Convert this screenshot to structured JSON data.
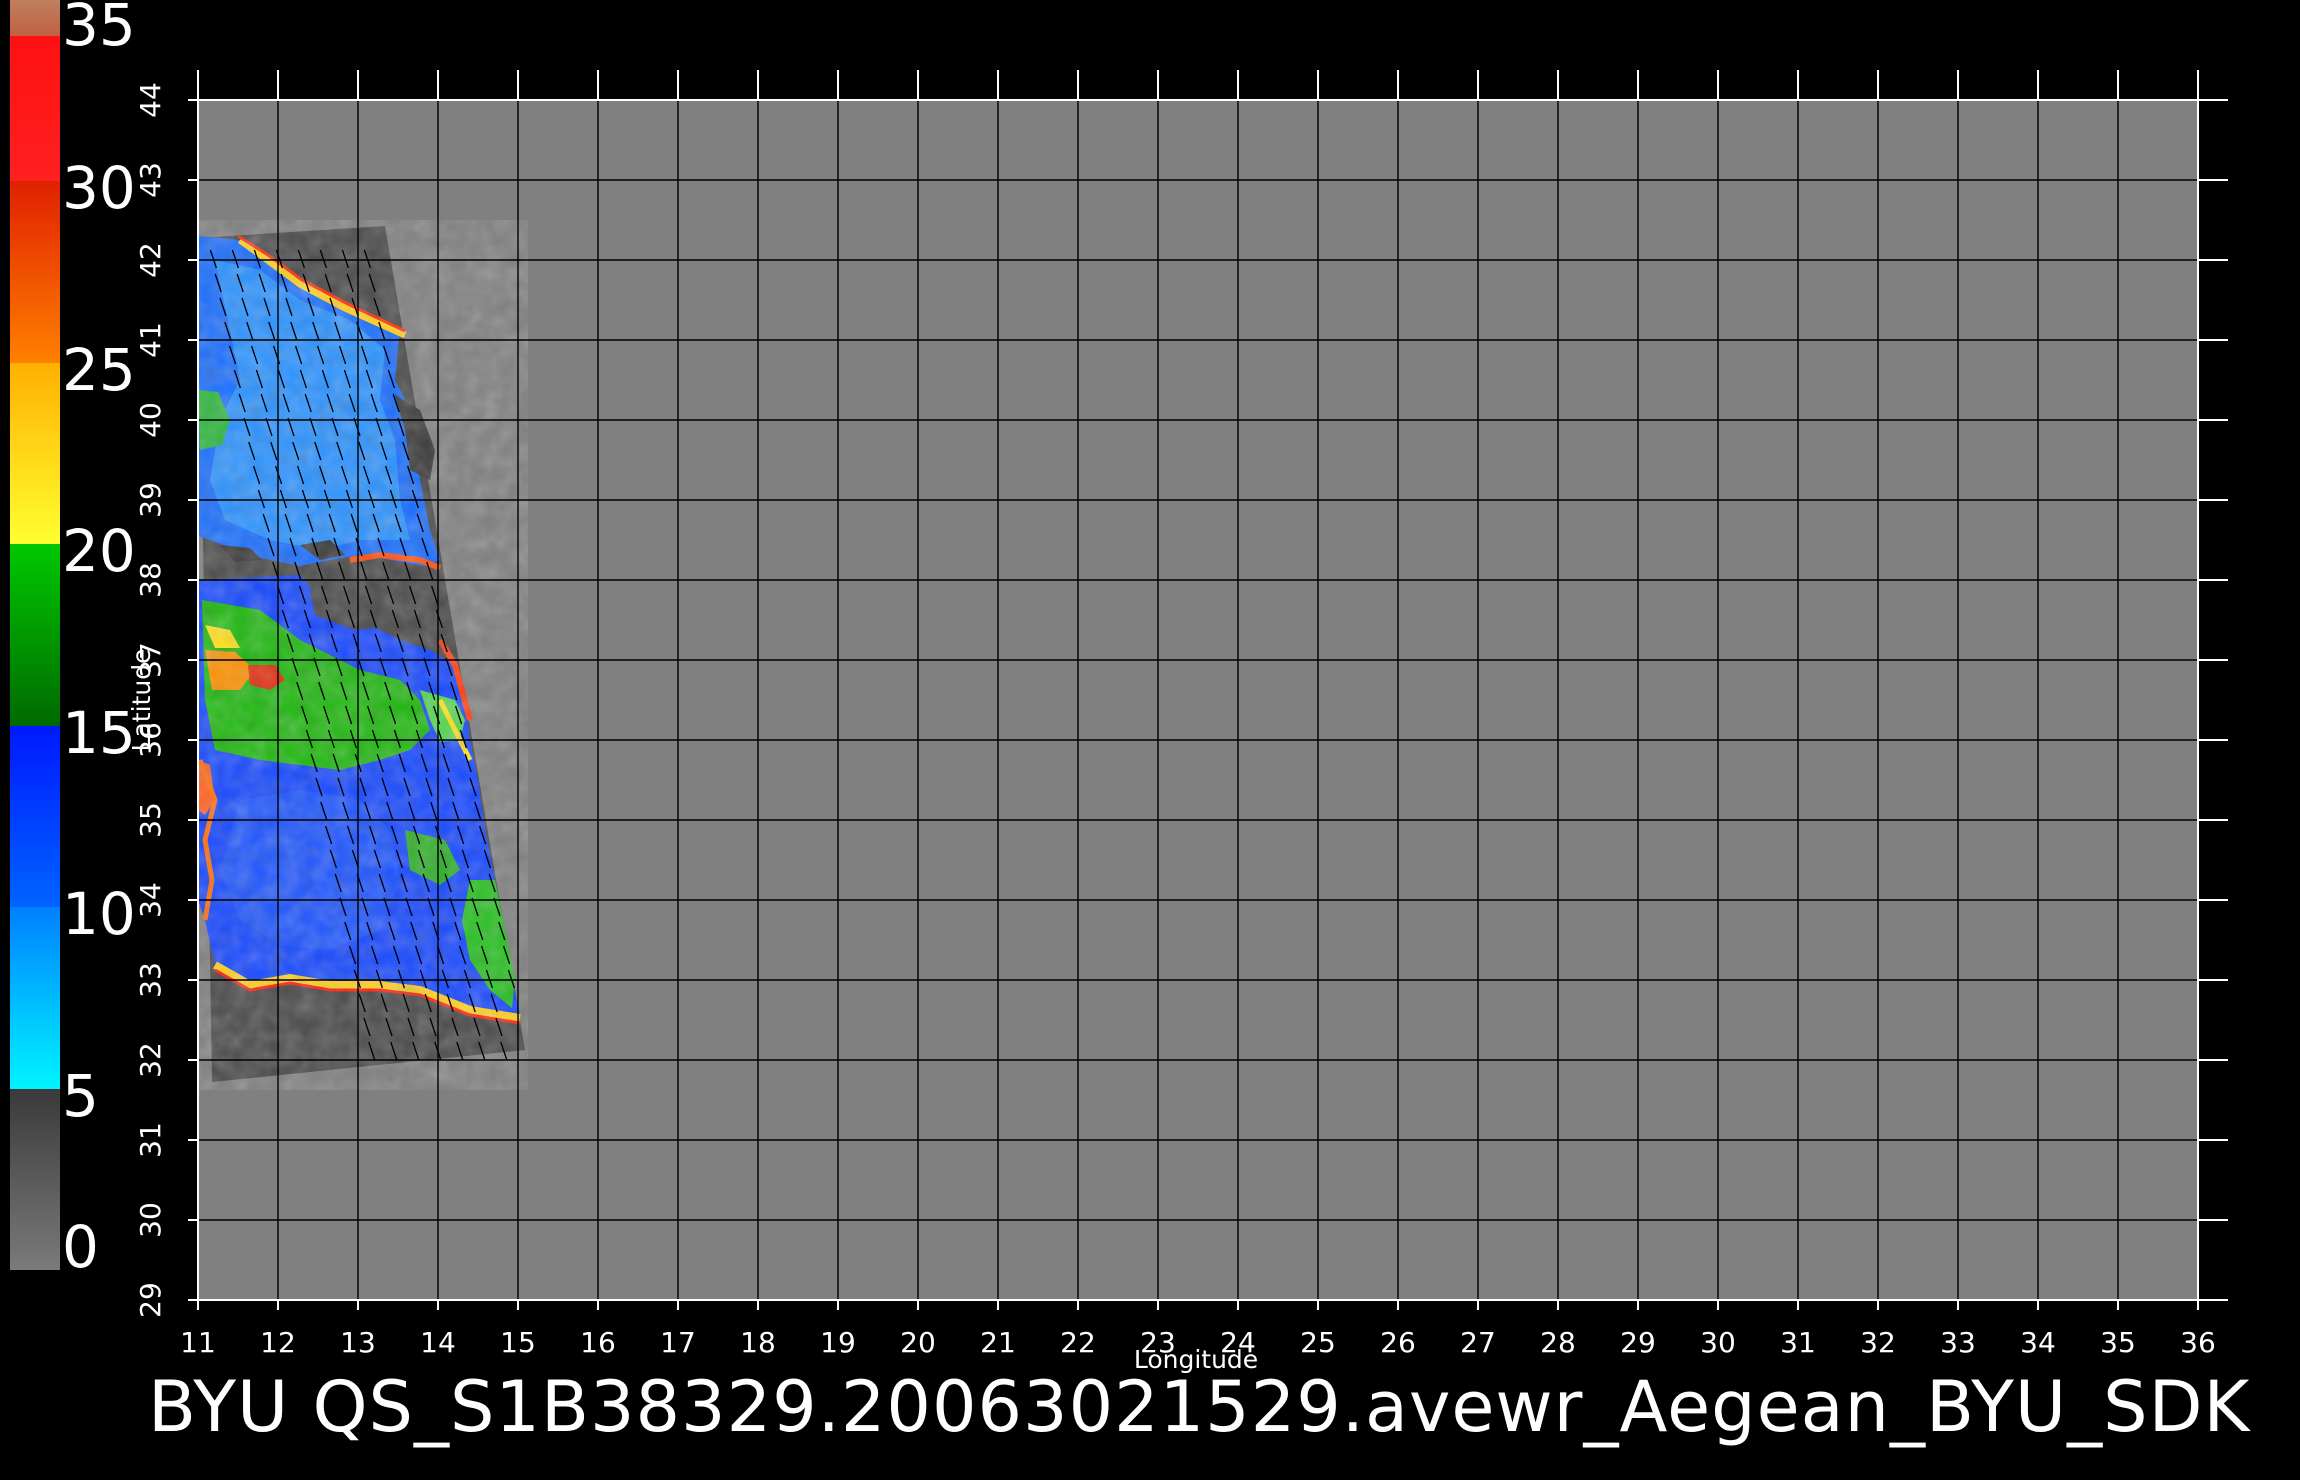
{
  "colorbar": {
    "labels": [
      "35",
      "30",
      "25",
      "20",
      "15",
      "10",
      "5",
      "0"
    ],
    "segments": [
      {
        "from": 0,
        "to": 5,
        "color_top": "#3a3a3a",
        "color_bottom": "#7a7a7a"
      },
      {
        "from": 5,
        "to": 10,
        "color_top": "#0080ff",
        "color_bottom": "#00f4ff"
      },
      {
        "from": 10,
        "to": 15,
        "color_top": "#0018ff",
        "color_bottom": "#0064ff"
      },
      {
        "from": 15,
        "to": 20,
        "color_top": "#00c800",
        "color_bottom": "#006a00"
      },
      {
        "from": 20,
        "to": 25,
        "color_top": "#ffb000",
        "color_bottom": "#ffff30"
      },
      {
        "from": 25,
        "to": 30,
        "color_top": "#e02000",
        "color_bottom": "#ff8000"
      },
      {
        "from": 30,
        "to": 34,
        "color_top": "#ff1010",
        "color_bottom": "#ff2020"
      },
      {
        "from": 34,
        "to": 35,
        "color_top": "#c08060",
        "color_bottom": "#c06040"
      }
    ]
  },
  "map": {
    "background_color": "#808080",
    "land_color": "#4a4a4a",
    "grid_color": "#000000",
    "xlabel": "Longitude",
    "ylabel": "Latitude",
    "lon_range": [
      11,
      36
    ],
    "lat_range": [
      29,
      44
    ],
    "lon_ticks": [
      "11",
      "12",
      "13",
      "14",
      "15",
      "16",
      "17",
      "18",
      "19",
      "20",
      "21",
      "22",
      "23",
      "24",
      "25",
      "26",
      "27",
      "28",
      "29",
      "30",
      "31",
      "32",
      "33",
      "34",
      "35",
      "36"
    ],
    "lat_ticks": [
      "29",
      "30",
      "31",
      "32",
      "33",
      "34",
      "35",
      "36",
      "37",
      "38",
      "39",
      "40",
      "41",
      "42",
      "43",
      "44"
    ]
  },
  "caption": "BYU  QS_S1B38329.20063021529.avewr_Aegean_BYU_SDK"
}
